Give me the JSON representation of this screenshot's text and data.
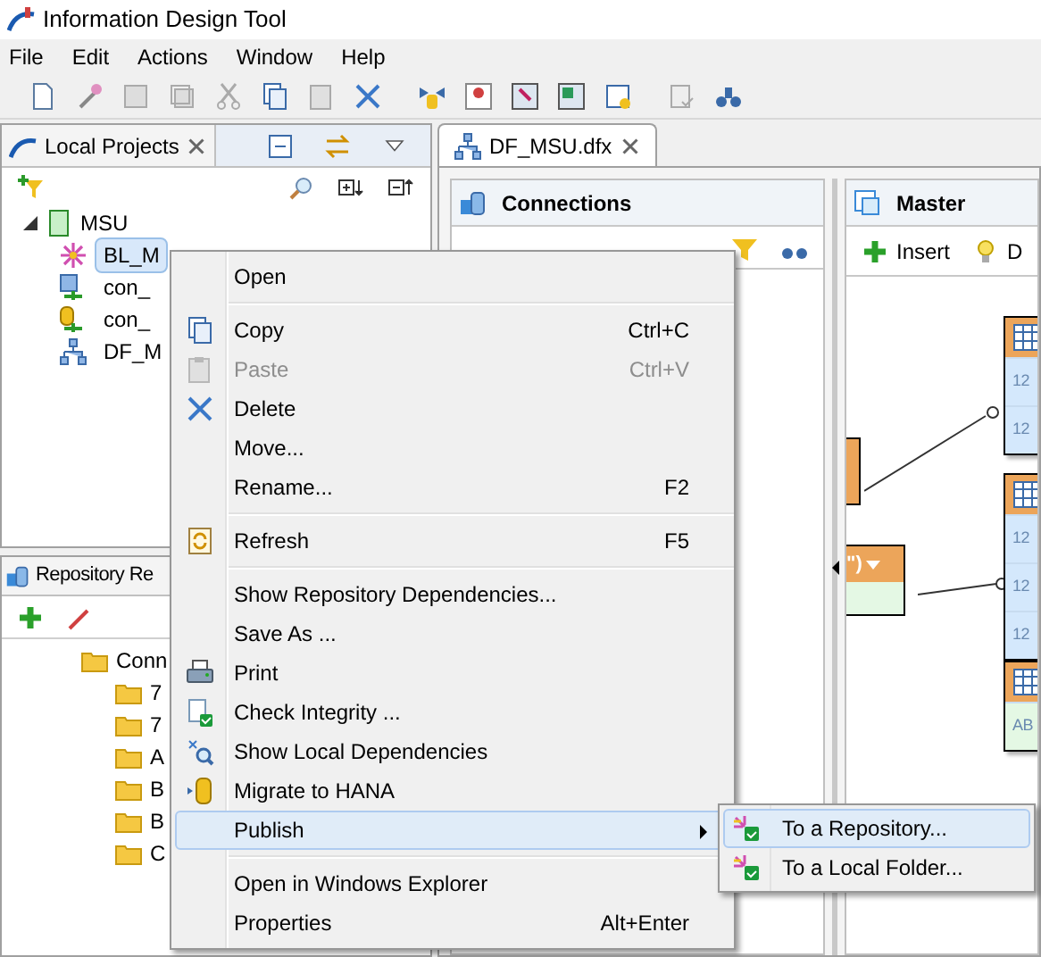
{
  "window": {
    "title": "Information Design Tool"
  },
  "menu_bar": [
    "File",
    "Edit",
    "Actions",
    "Window",
    "Help"
  ],
  "local_projects": {
    "title": "Local Projects",
    "tree": [
      {
        "label": "MSU",
        "expanded": true,
        "children": [
          {
            "label": "BL_M",
            "kind": "business-layer",
            "selected": true
          },
          {
            "label": "con_",
            "kind": "connection",
            "selected": false
          },
          {
            "label": "con_",
            "kind": "olap-connection",
            "selected": false
          },
          {
            "label": "DF_M",
            "kind": "foundation",
            "selected": false
          }
        ]
      }
    ]
  },
  "repository": {
    "title": "Repository Re",
    "tree": [
      {
        "label": "Conn",
        "children": [
          {
            "label": "7"
          },
          {
            "label": "7"
          },
          {
            "label": "A"
          },
          {
            "label": "B"
          },
          {
            "label": "B"
          },
          {
            "label": "C"
          }
        ]
      }
    ]
  },
  "editor": {
    "tab": "DF_MSU.dfx",
    "connections": {
      "title": "Connections"
    },
    "master": {
      "title": "Master",
      "insert": "Insert",
      "button_2": "D"
    },
    "tables": [
      {
        "rows": [
          "12",
          "12"
        ]
      },
      {
        "rows": [
          "12",
          "12",
          "12"
        ]
      },
      {
        "rows": [
          "AB"
        ]
      }
    ],
    "alias_label": "\")"
  },
  "context_menu": {
    "groups": [
      [
        {
          "label": "Open",
          "kind": "plain",
          "disabled": false,
          "selected": false,
          "submenu": false
        }
      ],
      [
        {
          "label": "Copy",
          "kind": "copy",
          "shortcut": "Ctrl+C",
          "disabled": false,
          "selected": false,
          "submenu": false
        },
        {
          "label": "Paste",
          "kind": "paste",
          "shortcut": "Ctrl+V",
          "disabled": true,
          "selected": false,
          "submenu": false
        },
        {
          "label": "Delete",
          "kind": "delete",
          "disabled": false,
          "selected": false,
          "submenu": false
        },
        {
          "label": "Move...",
          "kind": "plain",
          "disabled": false,
          "selected": false,
          "submenu": false
        },
        {
          "label": "Rename...",
          "kind": "plain",
          "shortcut": "F2",
          "disabled": false,
          "selected": false,
          "submenu": false
        }
      ],
      [
        {
          "label": "Refresh",
          "kind": "refresh",
          "shortcut": "F5",
          "disabled": false,
          "selected": false,
          "submenu": false
        }
      ],
      [
        {
          "label": "Show Repository Dependencies...",
          "kind": "plain",
          "disabled": false,
          "selected": false,
          "submenu": false
        },
        {
          "label": "Save As ...",
          "kind": "plain",
          "disabled": false,
          "selected": false,
          "submenu": false
        },
        {
          "label": "Print",
          "kind": "print",
          "disabled": false,
          "selected": false,
          "submenu": false
        },
        {
          "label": "Check Integrity ...",
          "kind": "check",
          "disabled": false,
          "selected": false,
          "submenu": false
        },
        {
          "label": "Show Local Dependencies",
          "kind": "search",
          "disabled": false,
          "selected": false,
          "submenu": false
        },
        {
          "label": "Migrate to HANA",
          "kind": "database",
          "disabled": false,
          "selected": false,
          "submenu": false
        },
        {
          "label": "Publish",
          "kind": "plain",
          "disabled": false,
          "selected": true,
          "submenu": true
        }
      ],
      [
        {
          "label": "Open in Windows Explorer",
          "kind": "plain",
          "disabled": false,
          "selected": false,
          "submenu": false
        },
        {
          "label": "Properties",
          "kind": "plain",
          "shortcut": "Alt+Enter",
          "disabled": false,
          "selected": false,
          "submenu": false
        }
      ]
    ]
  },
  "submenu": [
    {
      "label": "To a Repository...",
      "selected": true
    },
    {
      "label": "To a Local Folder...",
      "selected": false
    }
  ]
}
